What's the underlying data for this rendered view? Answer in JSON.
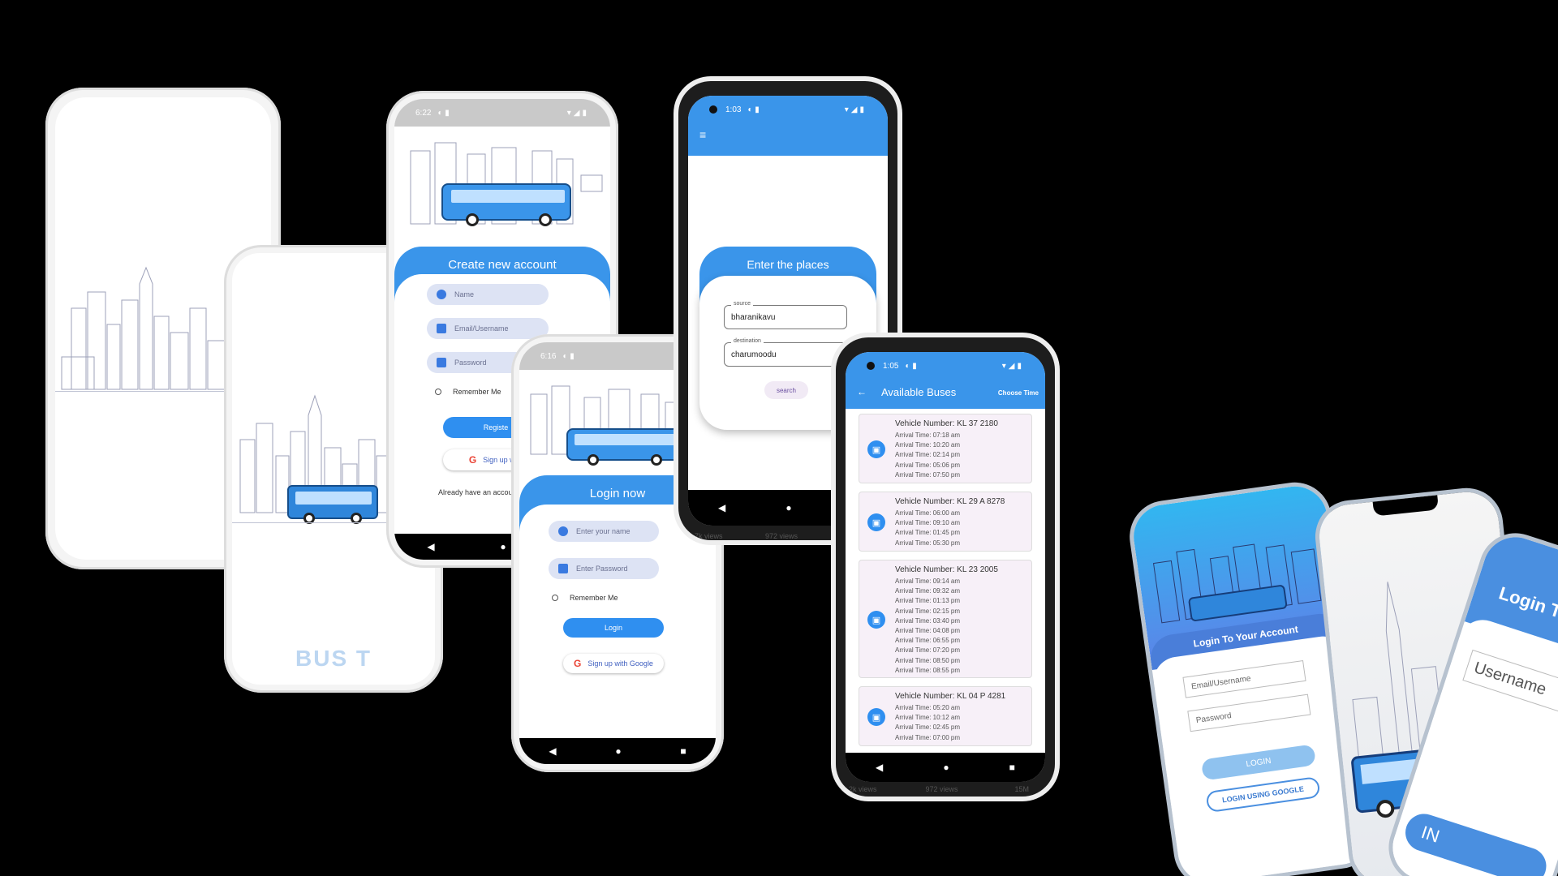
{
  "splash": {
    "logo_text": "BUS T"
  },
  "register": {
    "status_time": "6:22",
    "title": "Create new account",
    "name_placeholder": "Name",
    "email_placeholder": "Email/Username",
    "password_placeholder": "Password",
    "remember_label": "Remember Me",
    "register_label": "Registe",
    "google_label": "Sign up with",
    "have_account": "Already have an accou"
  },
  "login": {
    "status_time": "6:16",
    "title": "Login now",
    "name_placeholder": "Enter your name",
    "password_placeholder": "Enter Password",
    "remember_label": "Remember Me",
    "login_label": "Login",
    "google_label": "Sign up with Google"
  },
  "places": {
    "status_time": "1:03",
    "title": "Enter the places",
    "source_label": "source",
    "source_value": "bharanikavu",
    "destination_label": "destination",
    "destination_value": "charumoodu",
    "search_label": "search",
    "behind_text_1": "7k views",
    "behind_text_2": "972 views"
  },
  "buses": {
    "status_time": "1:05",
    "title": "Available Buses",
    "choose_time": "Choose Time",
    "behind_text_1": "2k views",
    "behind_text_2": "972 views",
    "behind_text_3": "15M",
    "list": [
      {
        "vehicle": "Vehicle Number: KL 37 2180",
        "times": [
          "Arrival Time: 07:18 am",
          "Arrival Time: 10:20 am",
          "Arrival Time: 02:14 pm",
          "Arrival Time: 05:06 pm",
          "Arrival Time: 07:50 pm"
        ]
      },
      {
        "vehicle": "Vehicle Number: KL 29 A 8278",
        "times": [
          "Arrival Time: 06:00 am",
          "Arrival Time: 09:10 am",
          "Arrival Time: 01:45 pm",
          "Arrival Time: 05:30 pm"
        ]
      },
      {
        "vehicle": "Vehicle Number: KL 23 2005",
        "times": [
          "Arrival Time: 09:14 am",
          "Arrival Time: 09:32 am",
          "Arrival Time: 01:13 pm",
          "Arrival Time: 02:15 pm",
          "Arrival Time: 03:40 pm",
          "Arrival Time: 04:08 pm",
          "Arrival Time: 06:55 pm",
          "Arrival Time: 07:20 pm",
          "Arrival Time: 08:50 pm",
          "Arrival Time: 08:55 pm"
        ]
      },
      {
        "vehicle": "Vehicle Number: KL 04 P 4281",
        "times": [
          "Arrival Time: 05:20 am",
          "Arrival Time: 10:12 am",
          "Arrival Time: 02:45 pm",
          "Arrival Time: 07:00 pm"
        ]
      }
    ]
  },
  "mockup_login": {
    "title": "Login To Your Account",
    "email_placeholder": "Email/Username",
    "password_placeholder": "Password",
    "login_label": "LOGIN",
    "google_label": "LOGIN USING GOOGLE"
  },
  "mockup_third": {
    "title": "Login To Y",
    "username": "Username",
    "button_fragment": "IN"
  },
  "colors": {
    "accent": "#3a95ea",
    "input_bg": "#dde3f4",
    "background": "#000000"
  }
}
